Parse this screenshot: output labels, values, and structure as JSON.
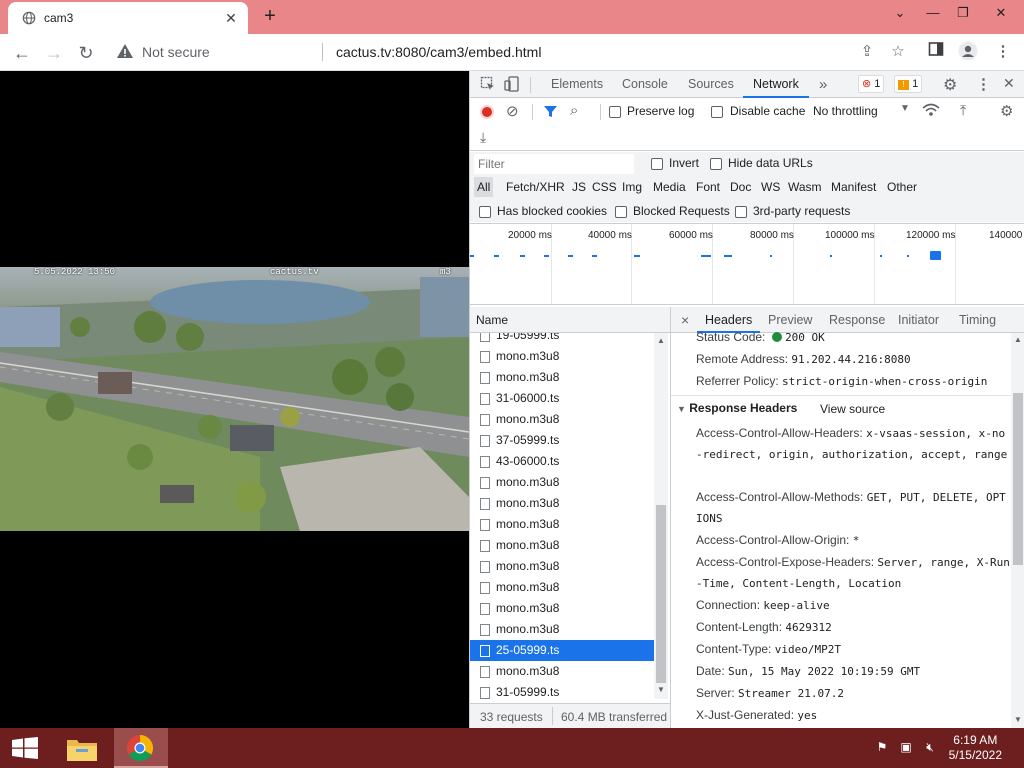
{
  "browser": {
    "tab_title": "cam3",
    "tab_close": "✕",
    "new_tab": "+",
    "not_secure": "Not secure",
    "url": "cactus.tv:8080/cam3/embed.html"
  },
  "video": {
    "osd_datetime": "5.05.2022 13:50",
    "osd_brand": "cactus.tv",
    "osd_channel": "m3"
  },
  "devtools": {
    "tabs": [
      "Elements",
      "Console",
      "Sources",
      "Network"
    ],
    "active_tab": "Network",
    "more_tabs": "»",
    "error_count": "1",
    "warning_count": "1",
    "toolbar": {
      "preserve_log": "Preserve log",
      "disable_cache": "Disable cache",
      "throttling": "No throttling"
    },
    "filter": {
      "placeholder": "Filter",
      "invert": "Invert",
      "hide_data_urls": "Hide data URLs",
      "types": [
        "All",
        "Fetch/XHR",
        "JS",
        "CSS",
        "Img",
        "Media",
        "Font",
        "Doc",
        "WS",
        "Wasm",
        "Manifest",
        "Other"
      ],
      "has_blocked_cookies": "Has blocked cookies",
      "blocked_requests": "Blocked Requests",
      "third_party": "3rd-party requests"
    },
    "timeline_ticks": [
      "20000 ms",
      "40000 ms",
      "60000 ms",
      "80000 ms",
      "100000 ms",
      "120000 ms",
      "140000"
    ],
    "request_list": {
      "header": "Name",
      "rows": [
        "19-05999.ts",
        "mono.m3u8",
        "mono.m3u8",
        "31-06000.ts",
        "mono.m3u8",
        "37-05999.ts",
        "43-06000.ts",
        "mono.m3u8",
        "mono.m3u8",
        "mono.m3u8",
        "mono.m3u8",
        "mono.m3u8",
        "mono.m3u8",
        "mono.m3u8",
        "mono.m3u8",
        "25-05999.ts",
        "mono.m3u8",
        "31-05999.ts"
      ],
      "selected_index": 15
    },
    "status": {
      "requests": "33 requests",
      "transferred": "60.4 MB transferred"
    },
    "detail_tabs": [
      "Headers",
      "Preview",
      "Response",
      "Initiator",
      "Timing"
    ],
    "detail_close": "×",
    "general": [
      {
        "key": "Status Code:",
        "value": "200 OK"
      },
      {
        "key": "Remote Address:",
        "value": "91.202.44.216:8080"
      },
      {
        "key": "Referrer Policy:",
        "value": "strict-origin-when-cross-origin"
      }
    ],
    "response_headers_title": "Response Headers",
    "view_source": "View source",
    "response_headers": [
      {
        "key": "Access-Control-Allow-Headers:",
        "value": "x-vsaas-session, x-no-redirect, origin, authorization, accept, range"
      },
      {
        "key": "Access-Control-Allow-Methods:",
        "value": "GET, PUT, DELETE, OPTIONS"
      },
      {
        "key": "Access-Control-Allow-Origin:",
        "value": "*"
      },
      {
        "key": "Access-Control-Expose-Headers:",
        "value": "Server, range, X-Run-Time, Content-Length, Location"
      },
      {
        "key": "Connection:",
        "value": "keep-alive"
      },
      {
        "key": "Content-Length:",
        "value": "4629312"
      },
      {
        "key": "Content-Type:",
        "value": "video/MP2T"
      },
      {
        "key": "Date:",
        "value": "Sun, 15 May 2022 10:19:59 GMT"
      },
      {
        "key": "Server:",
        "value": "Streamer 21.07.2"
      },
      {
        "key": "X-Just-Generated:",
        "value": "yes"
      }
    ]
  },
  "taskbar": {
    "time": "6:19 AM",
    "date": "5/15/2022"
  },
  "colors": {
    "titlebar": "#e8868a",
    "taskbar": "#6d1f1f",
    "accent": "#1a73e8",
    "record": "#d93025"
  }
}
